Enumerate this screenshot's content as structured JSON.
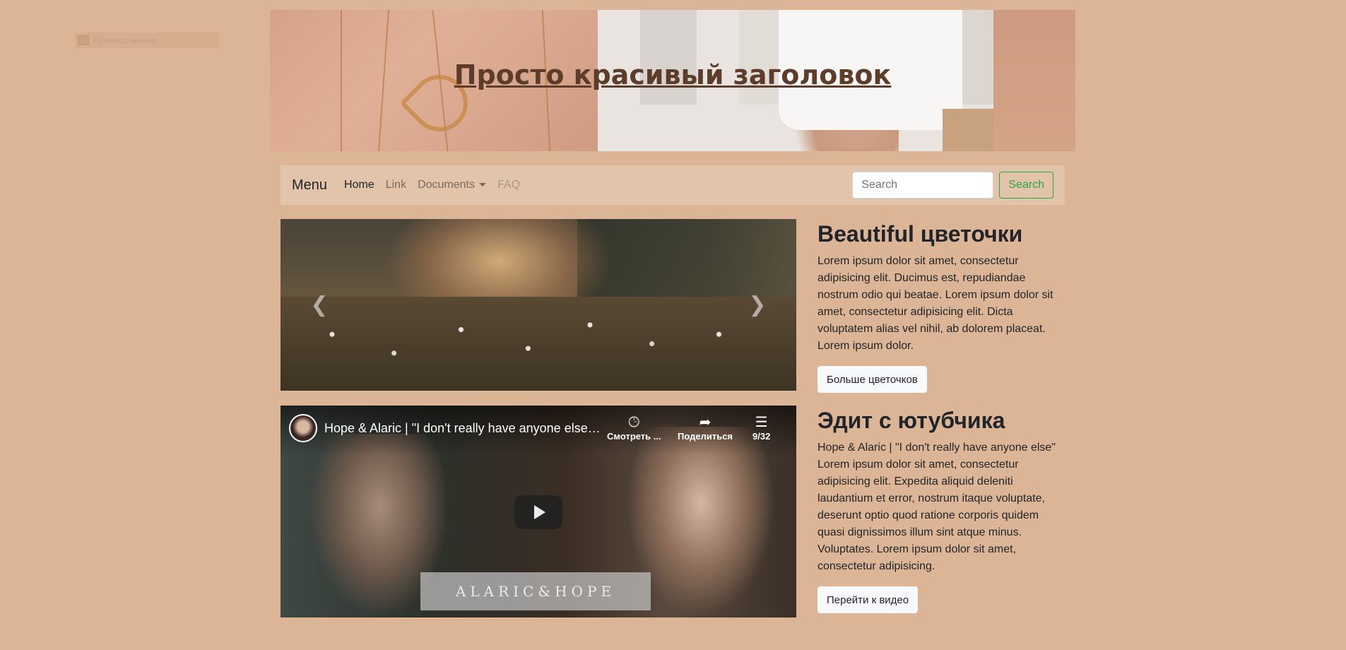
{
  "broken_image": {
    "alt": "Приветственник"
  },
  "header": {
    "title": "Просто красивый заголовок"
  },
  "navbar": {
    "brand": "Menu",
    "links": [
      {
        "label": "Home",
        "active": true
      },
      {
        "label": "Link"
      },
      {
        "label": "Documents",
        "dropdown": true
      },
      {
        "label": "FAQ",
        "disabled": true
      }
    ],
    "search": {
      "placeholder": "Search",
      "button_label": "Search"
    }
  },
  "carousel": {
    "prev_icon": "chevron-left-icon",
    "next_icon": "chevron-right-icon"
  },
  "video": {
    "title": "Hope & Alaric | \"I don't really have anyone else\" ...",
    "watch_later_label": "Смотреть ...",
    "share_label": "Поделиться",
    "playlist_count": "9/32",
    "caption": "ALARIC&HOPE"
  },
  "section1": {
    "heading": "Beautiful цветочки",
    "text": "Lorem ipsum dolor sit amet, consectetur adipisicing elit. Ducimus est, repudiandae nostrum odio qui beatae. Lorem ipsum dolor sit amet, consectetur adipisicing elit. Dicta voluptatem alias vel nihil, ab dolorem placeat. Lorem ipsum dolor.",
    "button": "Больше цветочков"
  },
  "section2": {
    "heading": "Эдит с ютубчика",
    "text": "Hope & Alaric | \"I don't really have anyone else\" Lorem ipsum dolor sit amet, consectetur adipisicing elit. Expedita aliquid deleniti laudantium et error, nostrum itaque voluptate, deserunt optio quod ratione corporis quidem quasi dignissimos illum sint atque minus. Voluptates. Lorem ipsum dolor sit amet, consectetur adipisicing.",
    "button": "Перейти к видео"
  },
  "colors": {
    "page_bg": "#dcb596",
    "navbar_bg": "#e1c4aa",
    "success": "#28a745",
    "title": "#5c3d2a"
  }
}
